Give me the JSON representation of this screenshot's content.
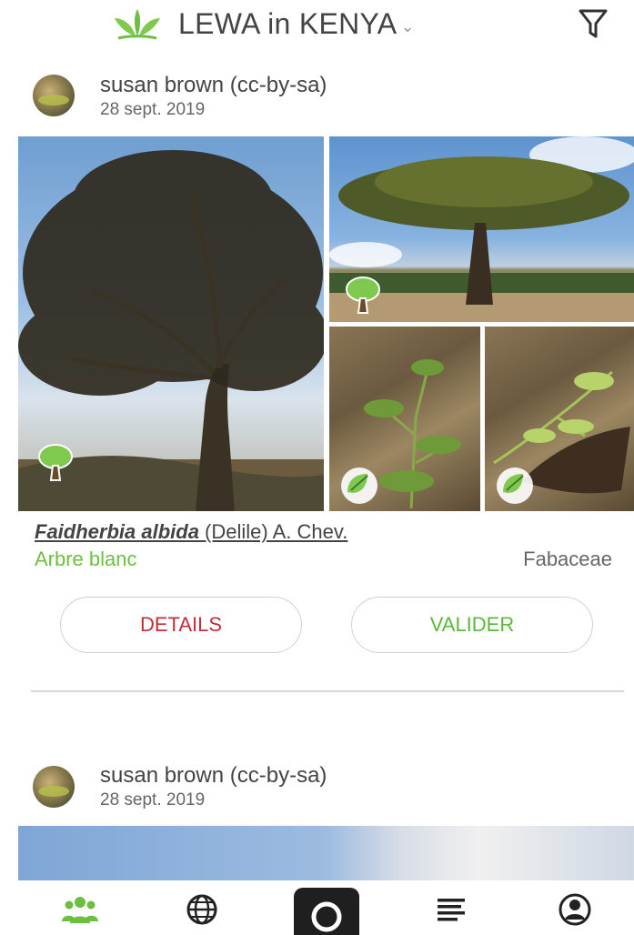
{
  "header": {
    "title": "LEWA in KENYA",
    "chevron": "⌄",
    "logo_icon": "leaf-logo-icon",
    "filter_icon": "filter-icon"
  },
  "posts": [
    {
      "author": "susan brown (cc-by-sa)",
      "date": "28 sept. 2019",
      "species": {
        "genus_species": "Faidherbia albida",
        "authority": " (Delile) A. Chev.",
        "common_name": "Arbre blanc",
        "family": "Fabaceae"
      },
      "photo_badges": [
        "tree-icon",
        "tree-icon",
        "leaf-icon",
        "leaf-icon"
      ],
      "actions": {
        "details": "DETAILS",
        "validate": "VALIDER"
      }
    },
    {
      "author": "susan brown (cc-by-sa)",
      "date": "28 sept. 2019"
    }
  ],
  "nav": {
    "items": [
      "community-icon",
      "globe-icon",
      "camera-icon",
      "list-icon",
      "profile-icon"
    ],
    "active": "community-icon"
  },
  "colors": {
    "accent_green": "#6cbf3f",
    "details_red": "#c0303a",
    "header_text": "#444444"
  }
}
